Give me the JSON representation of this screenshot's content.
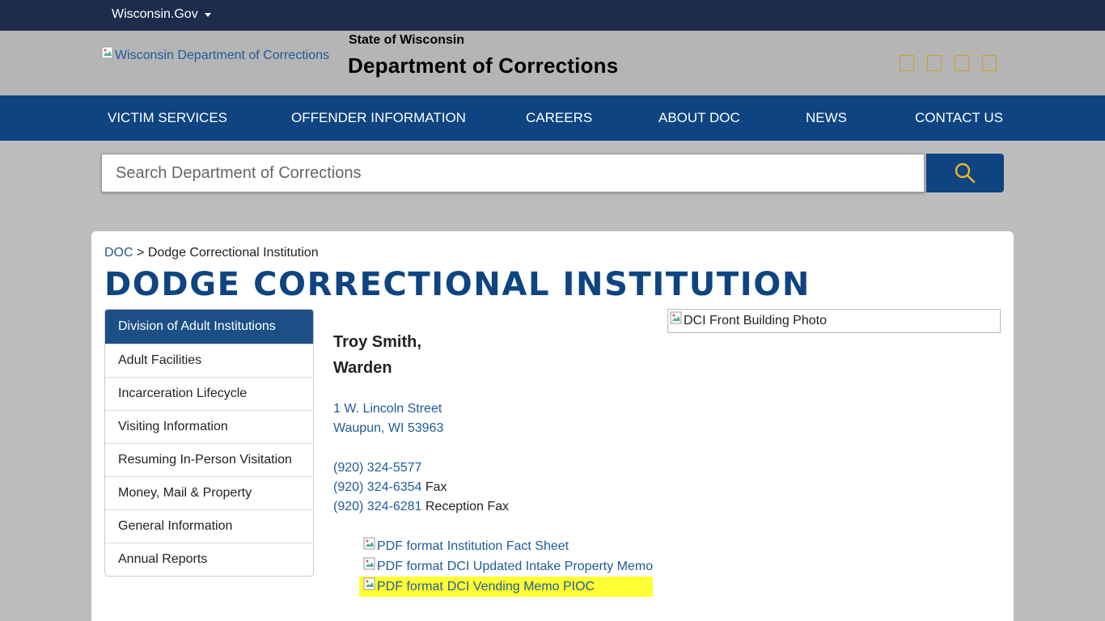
{
  "topbar": {
    "label": "Wisconsin.Gov"
  },
  "header": {
    "logo_alt": "Wisconsin Department of Corrections",
    "state": "State of Wisconsin",
    "department": "Department of Corrections"
  },
  "nav": {
    "items": [
      {
        "label": "VICTIM SERVICES"
      },
      {
        "label": "OFFENDER INFORMATION"
      },
      {
        "label": "CAREERS"
      },
      {
        "label": "ABOUT DOC"
      },
      {
        "label": "NEWS"
      },
      {
        "label": "CONTACT US"
      }
    ]
  },
  "search": {
    "placeholder": "Search Department of Corrections"
  },
  "breadcrumb": {
    "root": "DOC",
    "separator": ">",
    "current": "Dodge Correctional Institution"
  },
  "page_title": "DODGE CORRECTIONAL INSTITUTION",
  "sidebar": {
    "items": [
      {
        "label": "Division of Adult Institutions"
      },
      {
        "label": "Adult Facilities"
      },
      {
        "label": "Incarceration Lifecycle"
      },
      {
        "label": "Visiting Information"
      },
      {
        "label": "Resuming In-Person Visitation"
      },
      {
        "label": "Money, Mail & Property"
      },
      {
        "label": "General Information"
      },
      {
        "label": "Annual Reports"
      }
    ]
  },
  "contact": {
    "name": "Troy Smith,",
    "role": "Warden",
    "address_line1": "1 W. Lincoln Street",
    "address_line2": "Waupun, WI 53963",
    "phones": [
      {
        "number": "(920) 324-5577",
        "label": ""
      },
      {
        "number": "(920) 324-6354",
        "label": "Fax"
      },
      {
        "number": "(920) 324-6281",
        "label": "Reception Fax"
      }
    ]
  },
  "documents": [
    {
      "icon_alt": "PDF format",
      "label": "Institution Fact Sheet"
    },
    {
      "icon_alt": "PDF format",
      "label": "DCI Updated Intake Property Memo"
    },
    {
      "icon_alt": "PDF format",
      "label": "DCI Vending Memo PIOC"
    }
  ],
  "photo_alt": "DCI Front Building Photo",
  "colors": {
    "nav_bg": "#0e4481",
    "topbar_bg": "#1d2b4c",
    "title": "#0e4481",
    "link": "#1f5b99",
    "highlight": "#ffff33",
    "social_icon": "#c9a227"
  },
  "icons": {
    "search": "search-icon",
    "social": [
      "facebook-icon",
      "twitter-icon",
      "instagram-icon",
      "youtube-icon"
    ]
  }
}
